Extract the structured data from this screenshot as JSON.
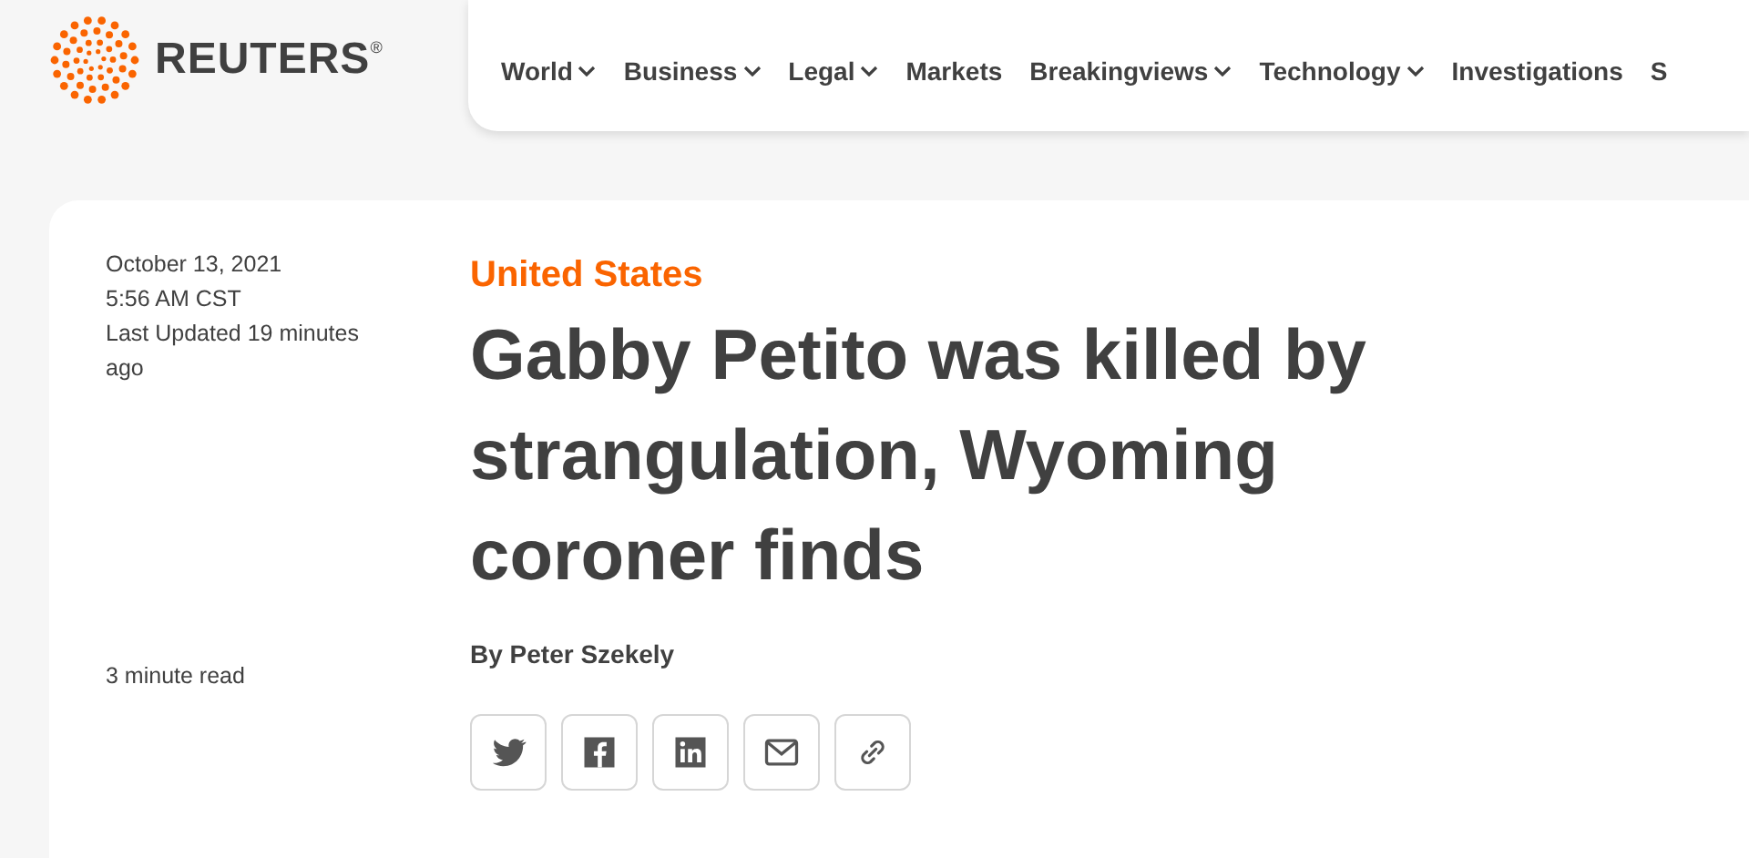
{
  "header": {
    "brand": "REUTERS",
    "brand_mark": "®",
    "nav": [
      {
        "label": "World",
        "dropdown": true
      },
      {
        "label": "Business",
        "dropdown": true
      },
      {
        "label": "Legal",
        "dropdown": true
      },
      {
        "label": "Markets",
        "dropdown": false
      },
      {
        "label": "Breakingviews",
        "dropdown": true
      },
      {
        "label": "Technology",
        "dropdown": true
      },
      {
        "label": "Investigations",
        "dropdown": false
      },
      {
        "label": "S",
        "dropdown": false
      }
    ]
  },
  "article": {
    "date": "October 13, 2021",
    "time": "5:56 AM CST",
    "updated": "Last Updated 19 minutes ago",
    "read_time": "3 minute read",
    "section": "United States",
    "headline": "Gabby Petito was killed by strangulation, Wyoming coroner finds",
    "byline": "By Peter Szekely",
    "share": [
      {
        "kind": "twitter"
      },
      {
        "kind": "facebook"
      },
      {
        "kind": "linkedin"
      },
      {
        "kind": "email"
      },
      {
        "kind": "link"
      }
    ]
  }
}
